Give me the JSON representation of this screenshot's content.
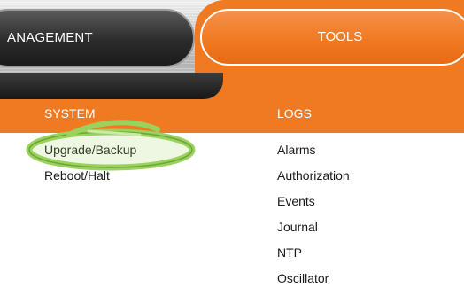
{
  "nav": {
    "management_label": "ANAGEMENT",
    "tools_label": "TOOLS"
  },
  "menu": {
    "system": {
      "title": "SYSTEM",
      "items": [
        "Upgrade/Backup",
        "Reboot/Halt"
      ]
    },
    "logs": {
      "title": "LOGS",
      "items": [
        "Alarms",
        "Authorization",
        "Events",
        "Journal",
        "NTP",
        "Oscillator"
      ]
    }
  },
  "colors": {
    "accent": "#f07a22",
    "dark_tab": "#2b2b2b",
    "highlight_ring": "#9bd15c"
  },
  "annotation": {
    "type": "highlight-ring",
    "target": "Upgrade/Backup"
  }
}
